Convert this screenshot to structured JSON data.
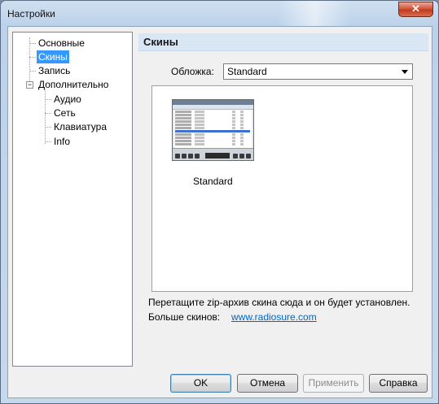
{
  "window": {
    "title": "Настройки",
    "close_glyph": "✕"
  },
  "tree": {
    "items": [
      {
        "label": "Основные"
      },
      {
        "label": "Скины"
      },
      {
        "label": "Запись"
      },
      {
        "label": "Дополнительно"
      },
      {
        "label": "Аудио"
      },
      {
        "label": "Сеть"
      },
      {
        "label": "Клавиатура"
      },
      {
        "label": "Info"
      }
    ],
    "expander_glyph": "−"
  },
  "section": {
    "title": "Скины"
  },
  "skin": {
    "label": "Обложка:",
    "selected": "Standard",
    "preview_name": "Standard"
  },
  "hint": "Перетащите zip-архив скина сюда и он будет установлен.",
  "more": {
    "label": "Больше скинов:",
    "link": "www.radiosure.com"
  },
  "buttons": {
    "ok": "OK",
    "cancel": "Отмена",
    "apply": "Применить",
    "help": "Справка"
  },
  "colors": {
    "selection": "#3399ff",
    "link": "#0066cc",
    "header": "#d9e6f4"
  }
}
